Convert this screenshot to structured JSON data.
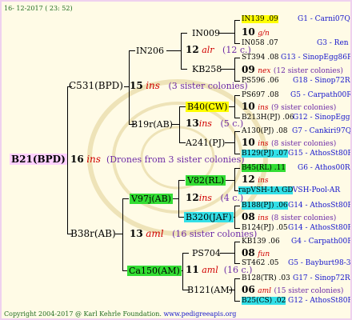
{
  "header": {
    "date": "16- 12-2017 ( 23: 52)"
  },
  "footer": {
    "copyright": "Copyright 2004-2017 @ Karl Kehrle Foundation.",
    "url": "www.pedigreeapis.org"
  },
  "root": {
    "name": "B21(BPD)",
    "gen": "16",
    "mark": "ins",
    "note": "(Drones from 3 sister colonies)"
  },
  "gen1": [
    {
      "name": "C531(BPD)",
      "gen": "15",
      "mark": "ins",
      "note": "(3 sister colonies)"
    },
    {
      "name": "B38r(AB)",
      "gen": "13",
      "mark": "aml",
      "note": "(16 sister colonies)"
    }
  ],
  "gen2": [
    {
      "name": "IN206",
      "gen": "12",
      "mark": "alr",
      "note": "(12 c.)"
    },
    {
      "name": "B19r(AB)",
      "gen": "13",
      "mark": "ins",
      "note": "(5 c.)"
    },
    {
      "name": "V97j(AB)",
      "gen": "12",
      "mark": "ins",
      "note": "(4 c.)"
    },
    {
      "name": "Ca150(AM)",
      "gen": "11",
      "mark": "aml",
      "note": "(16 c.)"
    }
  ],
  "gen3": [
    {
      "name": "IN009"
    },
    {
      "name": "KB258"
    },
    {
      "name": "B40(CW)"
    },
    {
      "name": "A241(PJ)"
    },
    {
      "name": "V82(RL)"
    },
    {
      "name": "B320(JAF)"
    },
    {
      "name": "PS704"
    },
    {
      "name": "B121(AM)"
    }
  ],
  "gen4": [
    {
      "name": "IN139 .09",
      "info": "G1 - Carni07Q"
    },
    {
      "gen": "10",
      "mark": "g/n",
      "note": ""
    },
    {
      "name": "IN058 .07",
      "info": "G3 - Ren"
    },
    {
      "name": "ST394 .08",
      "info": "G13 - SinopEgg86R"
    },
    {
      "gen": "09",
      "mark": "nex",
      "note": "(12 sister colonies)"
    },
    {
      "name": "PS596 .06",
      "info": "G18 - Sinop72R"
    },
    {
      "name": "PS697 .08",
      "info": "G5 - Carpath00R"
    },
    {
      "gen": "10",
      "mark": "ins",
      "note": "(9 sister colonies)"
    },
    {
      "name": "B213H(PJ) .06",
      "info": "G12 - SinopEgg86R"
    },
    {
      "name": "A130(PJ) .08",
      "info": "G7 - Cankiri97Q"
    },
    {
      "gen": "10",
      "mark": "ins",
      "note": "(8 sister colonies)"
    },
    {
      "name": "B129(PJ) .07",
      "info": "G15 - AthosSt80R"
    },
    {
      "name": "B45(RL) .11",
      "info": "G6 - Athos00R"
    },
    {
      "gen": "12",
      "mark": "ins",
      "note": ""
    },
    {
      "name": "rapVSH-1A GD",
      "info": "- VSH-Pool-AR"
    },
    {
      "name": "B188(PJ) .06",
      "info": "G14 - AthosSt80R"
    },
    {
      "gen": "08",
      "mark": "ins",
      "note": "(8 sister colonies)"
    },
    {
      "name": "B124(PJ) .05",
      "info": "G14 - AthosSt80R"
    },
    {
      "name": "KB139 .06",
      "info": "G4 - Carpath00R"
    },
    {
      "gen": "08",
      "mark": "fun",
      "note": ""
    },
    {
      "name": "ST462 .05",
      "info": "G5 - Bayburt98-3"
    },
    {
      "name": "B128(TR) .03",
      "info": "G17 - Sinop72R"
    },
    {
      "gen": "06",
      "mark": "aml",
      "note": "(15 sister colonies)"
    },
    {
      "name": "B25(CS) .02",
      "info": "G12 - AthosSt80R"
    }
  ]
}
